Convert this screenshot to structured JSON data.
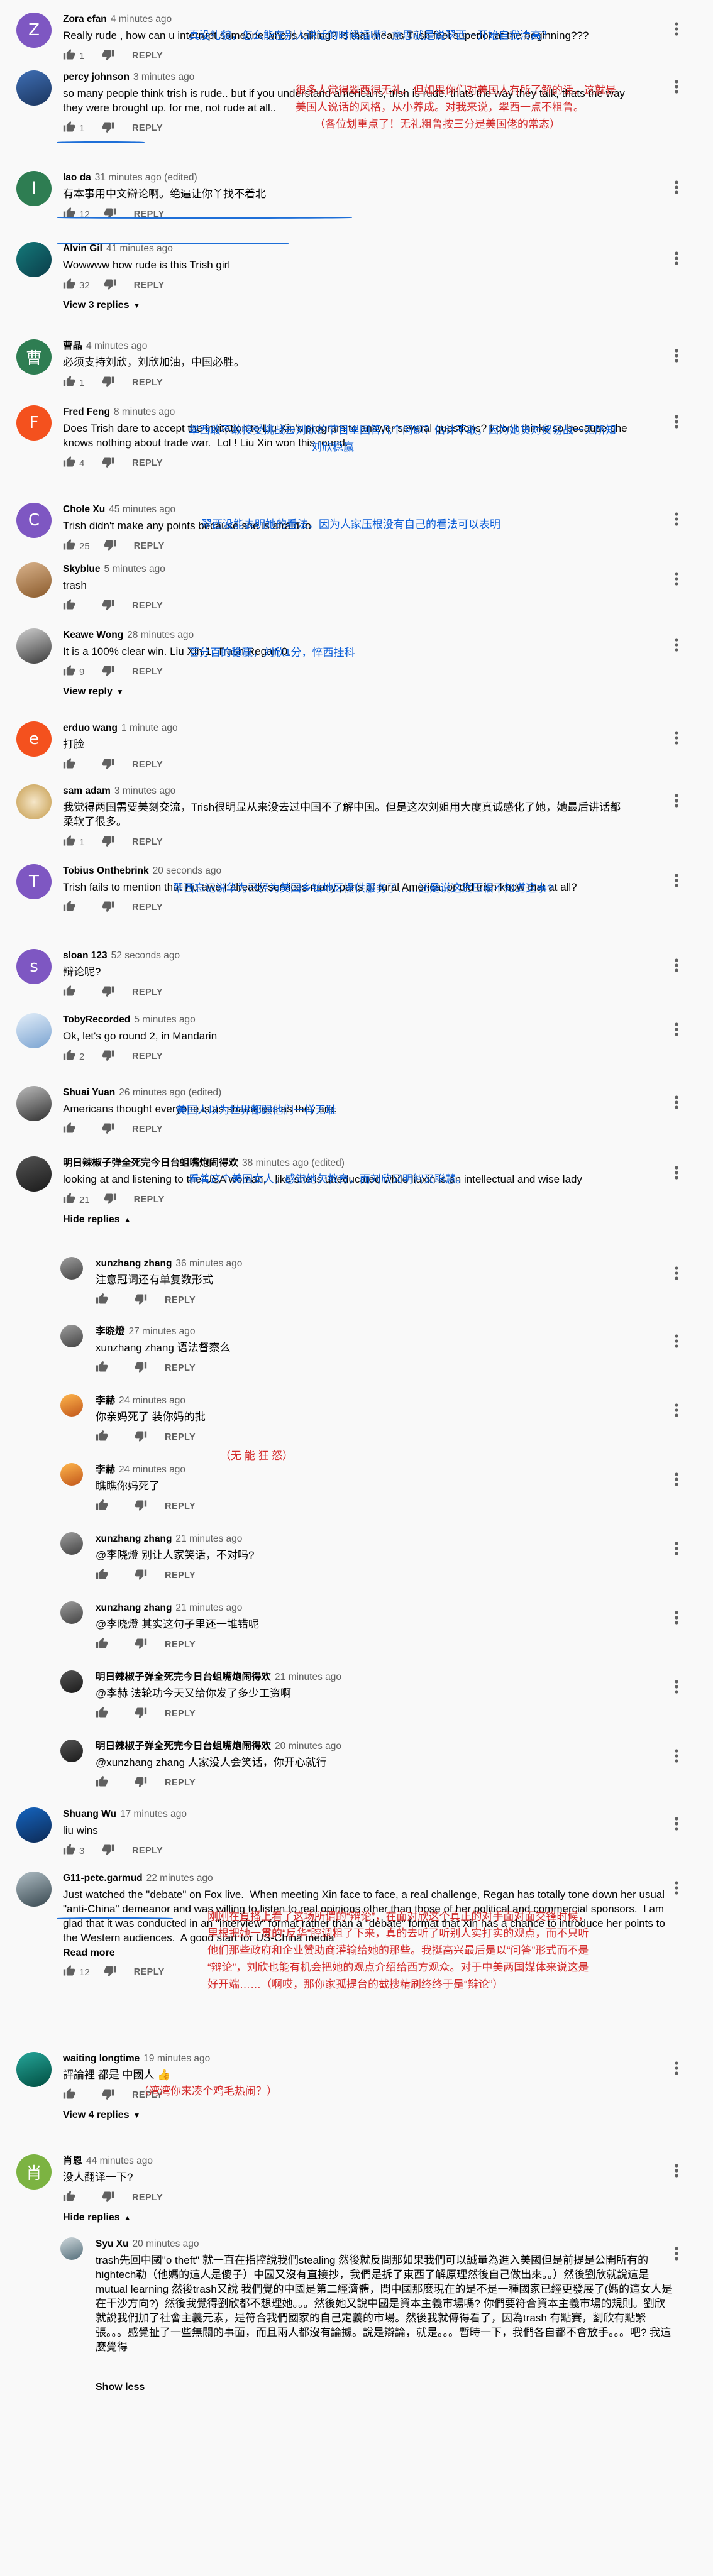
{
  "colors": {
    "link": "#065fd4",
    "annotation_blue": "#0a5dd8",
    "annotation_red": "#d42a2a",
    "meta": "#606060"
  },
  "labels": {
    "reply": "REPLY",
    "hide_replies": "Hide replies",
    "read_more": "Read more",
    "show_less": "Show less"
  },
  "icons": {
    "like": "thumb-up-icon",
    "dislike": "thumb-down-icon",
    "more": "more-vert-icon"
  },
  "comments": [
    {
      "author": "Zora efan",
      "time": "4 minutes ago",
      "text": "Really rude , how can u interrupt someone who is talking? Is that means Trish feel superior at the beginning???",
      "likes": "1",
      "annotations": [
        "真没礼貌，怎么能在别人讲话的时候插嘴？意思就是说翠西一开始自我清高？"
      ]
    },
    {
      "author": "percy johnson",
      "time": "3 minutes ago",
      "text": "so many people think trish is rude.. but if you understand americans, trish is rude. thats the way they talk, thats the way they were brought up. for me, not rude at all..",
      "likes": "1",
      "annotations": [
        "很多人觉得翠西很无礼。但如果你们对美国人有所了解的话，这就是",
        "美国人说话的风格，从小养成。对我来说，翠西一点不粗鲁。",
        "（各位划重点了！无礼粗鲁按三分是美国佬的常态）"
      ]
    },
    {
      "author": "lao da",
      "time": "31 minutes ago (edited)",
      "text": "有本事用中文辯论啊。绝逼让你丫找不着北",
      "likes": "12",
      "annotations": []
    },
    {
      "author": "Alvin Gil",
      "time": "41 minutes ago",
      "text": "Wowwww how rude is this Trish girl",
      "likes": "32",
      "annotations": [],
      "replies_label": "View 3 replies"
    },
    {
      "author": "曹晶",
      "time": "4 minutes ago",
      "text": "必须支持刘欣，刘欣加油，中国必胜。",
      "likes": "1",
      "annotations": []
    },
    {
      "author": "Fred Feng",
      "time": "8 minutes ago",
      "text": "Does Trish dare to accept the invitation to Liu Xin's program to answer several questions? I don't thinks so because she knows nothing about trade war.  Lol ! Liu Xin won this round.",
      "likes": "4",
      "annotations": [
        "翠西敢不敢接受挑战去刘欣的节目里回答几个问题？估计不敢，因为她货对贸易战一无所知",
        "刘欣稳赢"
      ]
    },
    {
      "author": "Chole Xu",
      "time": "45 minutes ago",
      "text": "Trish didn't make any points because she is afraid to",
      "likes": "25",
      "annotations": [
        "翠西没能表明她的看法，因为人家压根没有自己的看法可以表明"
      ]
    },
    {
      "author": "Skyblue",
      "time": "5 minutes ago",
      "text": "trash",
      "likes": "",
      "annotations": []
    },
    {
      "author": "Keawe Wong",
      "time": "28 minutes ago",
      "text": "It is a 100% clear win. Liu Xin 1. Trash Regan 0.",
      "likes": "9",
      "annotations": [
        "百分百的稳赢，刘欣1分，悴西挂科"
      ],
      "replies_label": "View reply"
    },
    {
      "author": "erduo wang",
      "time": "1 minute ago",
      "text": "打脸",
      "likes": "",
      "annotations": []
    },
    {
      "author": "sam adam",
      "time": "3 minutes ago",
      "text": "我觉得两国需要美刻交流，Trish很明显从来没去过中国不了解中国。但是这次刘姐用大度真诚感化了她，她最后讲话都柔软了很多。",
      "likes": "1",
      "annotations": []
    },
    {
      "author": "Tobius Onthebrink",
      "time": "20 seconds ago",
      "text": "Trish fails to mention that Hu awe I already services many parts of rural America, or did trish know that at all?",
      "likes": "",
      "annotations": [
        "翠西忘记说华为已经为美国乡镇地区提供服务了……还是说这货压根不知道这事?"
      ]
    },
    {
      "author": "sloan 123",
      "time": "52 seconds ago",
      "text": "辩论呢?",
      "likes": "",
      "annotations": []
    },
    {
      "author": "TobyRecorded",
      "time": "5 minutes ago",
      "text": "Ok, let's go round 2, in Mandarin",
      "likes": "2",
      "annotations": []
    },
    {
      "author": "Shuai Yuan",
      "time": "26 minutes ago (edited)",
      "text": "Americans thought everyone is as shameless as they are.",
      "likes": "",
      "annotations": [
        "美国人以为世界都跟他们一样无耻"
      ]
    },
    {
      "author": "明日辣椒子弹全死完今日台蛆嘴炮闹得欢",
      "time": "38 minutes ago (edited)",
      "text": "looking at and listening to the USA woman,   like she is uneducated while liuxin is an intellectual and wise lady",
      "likes": "21",
      "annotations": [
        "看着这个美国女人，感觉她欠教育，而刘欣又明智又聪慧。"
      ],
      "replies_label": "Hide replies"
    },
    {
      "author": "xunzhang zhang",
      "time": "36 minutes ago",
      "text": "注意冠词还有单复数形式",
      "likes": "",
      "annotations": []
    },
    {
      "author": "李晓燈",
      "time": "27 minutes ago",
      "text": "xunzhang zhang 语法督察么",
      "likes": "",
      "annotations": []
    },
    {
      "author": "李赫",
      "time": "24 minutes ago",
      "text": "你亲妈死了 装你妈的批",
      "likes": "",
      "annotations": []
    },
    {
      "author": "李赫",
      "time": "24 minutes ago",
      "text": "瞧瞧你妈死了",
      "likes": "",
      "annotations": [
        "（无 能 狂 怒）"
      ]
    },
    {
      "author": "xunzhang zhang",
      "time": "21 minutes ago",
      "text": "@李晓燈 别让人家笑话，不对吗?",
      "likes": "",
      "annotations": []
    },
    {
      "author": "xunzhang zhang",
      "time": "21 minutes ago",
      "text": "@李晓燈 其实这句子里还一堆错呢",
      "likes": "",
      "annotations": []
    },
    {
      "author": "明日辣椒子弹全死完今日台蛆嘴炮闹得欢",
      "time": "21 minutes ago",
      "text": "@李赫 法轮功今天又给你发了多少工资啊",
      "likes": "",
      "annotations": []
    },
    {
      "author": "明日辣椒子弹全死完今日台蛆嘴炮闹得欢",
      "time": "20 minutes ago",
      "text": "@xunzhang zhang 人家没人会笑话，你开心就行",
      "likes": "",
      "annotations": []
    },
    {
      "author": "Shuang Wu",
      "time": "17 minutes ago",
      "text": "liu wins",
      "likes": "3",
      "annotations": []
    },
    {
      "author": "G11-pete.garmud",
      "time": "22 minutes ago",
      "text": "Just watched the \"debate\" on Fox live.  When meeting Xin face to face, a real challenge, Regan has totally tone down her usual \"anti-China\" demeanor and was willing to listen to real opinions other than those of her political and commercial sponsors.  I am glad that it was conducted in an \"interview\" format rather than a \"debate\" format that Xin has a chance to introduce her points to the Western audiences.  A good start for US-China media",
      "likes": "12",
      "annotations": [
        "刚刚在直播上看了这场所谓的“辩论”，在面对欣这个真正的对手面对面交锋时候，",
        "里根把她一贯的“反华”腔调粗了下来，真的去听了听别人实打实的观点，而不只听",
        "他们那些政府和企业赞助商灌输给她的那些。我挺高兴最后是以“问答”形式而不是",
        "“辩论”，刘欣也能有机会把她的观点介绍给西方观众。对于中美两国媒体来说这是",
        "好开端……（啊哎，那你家孤提台的截搜精刷终终于是“辩论”）"
      ]
    },
    {
      "author": "waiting longtime",
      "time": "19 minutes ago",
      "text": "評論裡 都是 中國人 👍",
      "likes": "",
      "annotations": [
        "（湾湾你来凑个鸡毛热闹？）"
      ],
      "replies_label": "View 4 replies"
    },
    {
      "author": "肖恩",
      "time": "44 minutes ago",
      "text": "没人翻译一下?",
      "likes": "",
      "annotations": [],
      "replies_label": "Hide replies"
    },
    {
      "author": "Syu Xu",
      "time": "20 minutes ago",
      "text": "trash先回中國\"o theft\" 就一直在指控說我們stealing 然後就反問那如果我們可以誠量為進入美國但是前提是公開所有的hightech勒（他媽的這人是傻子）中國又沒有直接抄，我們是拆了東西了解原理然後自己做出來。。）然後劉欣就說這是mutual learning 然後trash又說 我們覺的中國是第二經濟體，問中國那麼現在的是不是一種國家已經更發展了(媽的這女人是在干沙方向?)  然後我覺得劉欣都不想理她。。。然後她又說中國是資本主義市場嗎? 你們要符合資本主義市場的規則。劉欣就說我們加了社會主義元素，是符合我們國家的自己定義的市場。然後我就傳得看了，因為trash 有點賽，劉欣有點緊張。。。感覺扯了一些無關的事面，而且兩人都沒有論據。說是辯論，就是。。。暫時一下，我們各自都不會放手。。。吧? 我這麼覺得",
      "likes": "",
      "annotations": [],
      "replies_label": "Show less"
    }
  ]
}
